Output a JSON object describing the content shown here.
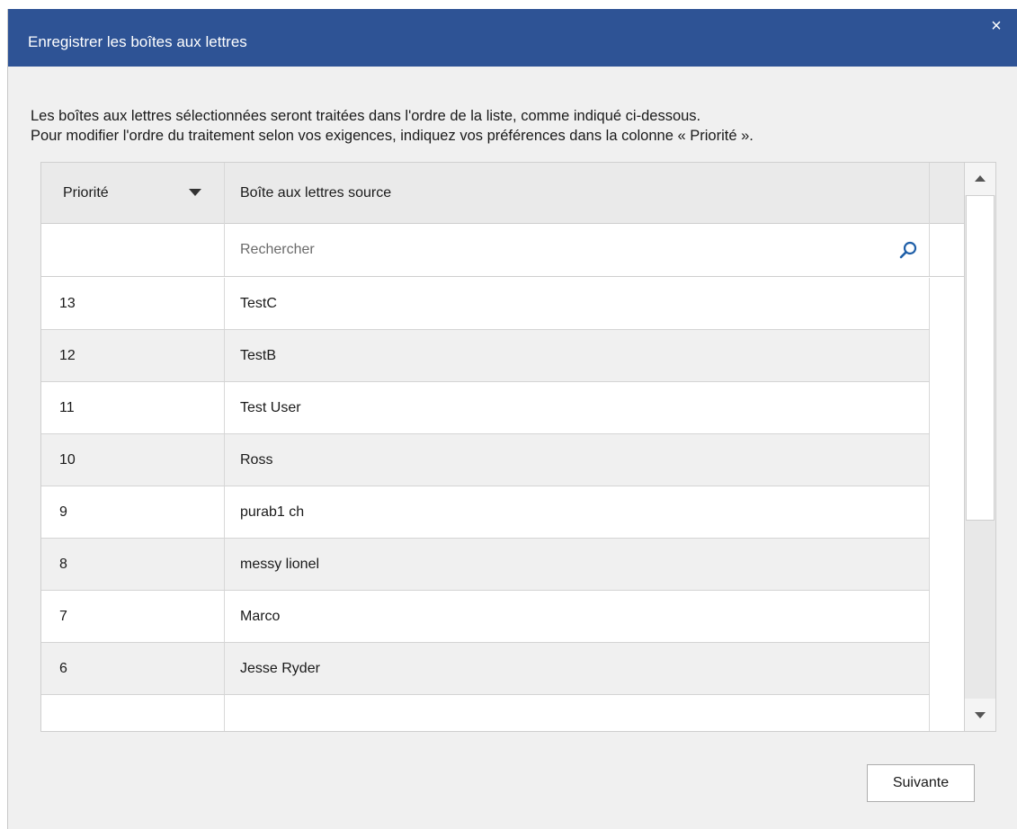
{
  "window": {
    "title": "Enregistrer les boîtes aux lettres",
    "close_glyph": "×"
  },
  "intro": {
    "line1": "Les boîtes aux lettres sélectionnées seront traitées dans l'ordre de la liste, comme indiqué ci-dessous.",
    "line2": "Pour modifier l'ordre du traitement selon vos exigences, indiquez vos préférences dans la colonne « Priorité »."
  },
  "table": {
    "columns": {
      "priority": "Priorité",
      "source": "Boîte aux lettres source"
    },
    "sort": "descending",
    "search": {
      "placeholder": "Rechercher",
      "value": ""
    },
    "rows": [
      {
        "priority": "13",
        "source": "TestC"
      },
      {
        "priority": "12",
        "source": "TestB"
      },
      {
        "priority": "11",
        "source": "Test User"
      },
      {
        "priority": "10",
        "source": "Ross"
      },
      {
        "priority": "9",
        "source": "purab1 ch"
      },
      {
        "priority": "8",
        "source": "messy lionel"
      },
      {
        "priority": "7",
        "source": "Marco"
      },
      {
        "priority": "6",
        "source": "Jesse Ryder"
      },
      {
        "priority": "",
        "source": ""
      }
    ]
  },
  "footer": {
    "next_label": "Suivante"
  },
  "colors": {
    "titlebar": "#2e5395",
    "row_alt": "#f0f0f0"
  },
  "icons": {
    "close": "close-icon",
    "sort": "sort-desc-icon",
    "search": "search-icon",
    "scroll_up": "scroll-up-icon",
    "scroll_down": "scroll-down-icon"
  }
}
